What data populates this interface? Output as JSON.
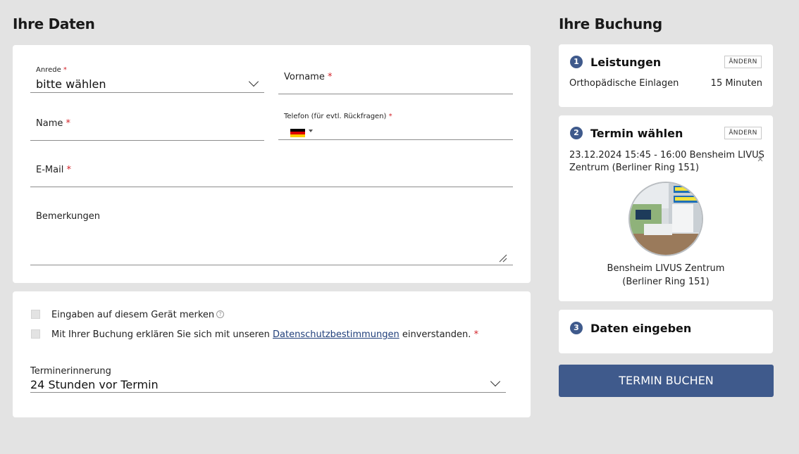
{
  "left_heading": "Ihre Daten",
  "right_heading": "Ihre Buchung",
  "form": {
    "anrede_label": "Anrede",
    "anrede_value": "bitte wählen",
    "vorname_label": "Vorname",
    "name_label": "Name",
    "telefon_label": "Telefon (für evtl. Rückfragen)",
    "email_label": "E-Mail",
    "bemerkungen_label": "Bemerkungen",
    "required_mark": "*"
  },
  "options": {
    "remember_label": "Eingaben auf diesem Gerät merken",
    "consent_prefix": "Mit Ihrer Buchung erklären Sie sich mit unseren ",
    "consent_link": "Datenschutzbestimmungen",
    "consent_suffix": " einverstanden.",
    "reminder_label": "Terminerinnerung",
    "reminder_value": "24 Stunden vor Termin"
  },
  "booking": {
    "step1_num": "1",
    "step1_title": "Leistungen",
    "change_label": "ÄNDERN",
    "service_name": "Orthopädische Einlagen",
    "service_duration": "15 Minuten",
    "step2_num": "2",
    "step2_title": "Termin wählen",
    "appointment_line1": "23.12.2024 15:45 - 16:00 Bensheim LIVUS",
    "appointment_line2": "Zentrum (Berliner Ring 151)",
    "location_line1": "Bensheim LIVUS Zentrum",
    "location_line2": "(Berliner Ring 151)",
    "step3_num": "3",
    "step3_title": "Daten eingeben",
    "book_label": "TERMIN BUCHEN"
  },
  "colors": {
    "accent": "#3f5a8c",
    "required": "#d3232a",
    "link": "#1f3e7a",
    "background": "#e3e3e3"
  }
}
